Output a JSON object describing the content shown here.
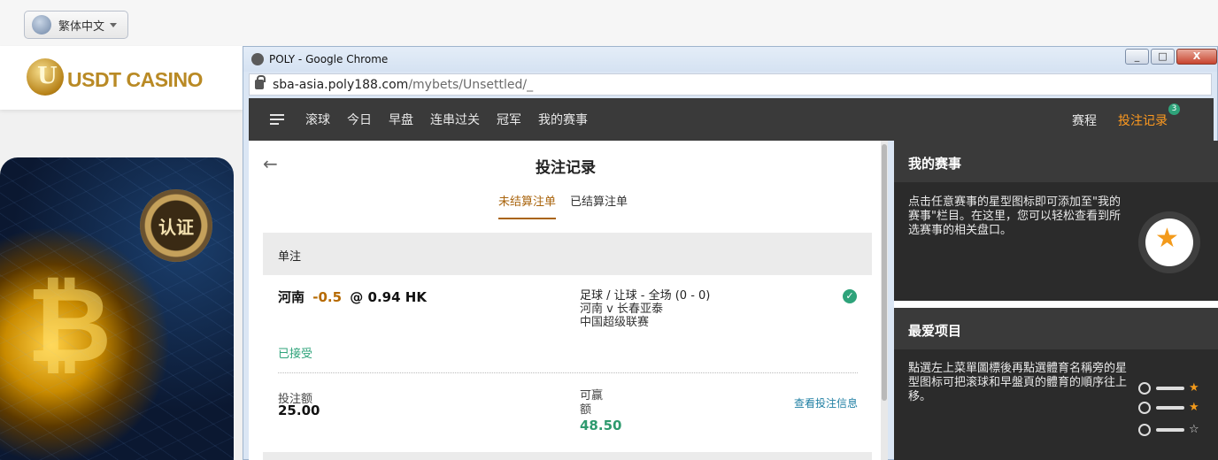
{
  "language": {
    "label": "繁体中文"
  },
  "site": {
    "brand": "USDT CASINO",
    "seal_text": "认证"
  },
  "browser": {
    "title": "POLY - Google Chrome",
    "url_host": "sba-asia.poly188.com",
    "url_path": "/mybets/Unsettled/_",
    "controls": {
      "minimize": "_",
      "maximize": "□",
      "close": "X"
    }
  },
  "nav": {
    "items": [
      "滚球",
      "今日",
      "早盘",
      "连串过关",
      "冠军",
      "我的赛事"
    ],
    "schedule": "赛程",
    "bet_record": "投注记录",
    "bet_record_count": "3"
  },
  "panel": {
    "title": "投注记录",
    "tabs": [
      "未结算注单",
      "已结算注单"
    ],
    "section": "单注",
    "bet": {
      "team": "河南",
      "handicap": "-0.5",
      "at": "@",
      "odds": "0.94 HK",
      "market": "足球 / 让球 - 全场 (0 - 0)",
      "match": "河南 v 长春亚泰",
      "league": "中国超级联赛",
      "status": "已接受",
      "stake_label": "投注额",
      "stake": "25.00",
      "win_label": "可赢额",
      "win": "48.50",
      "details_link": "查看投注信息"
    }
  },
  "sidebar": {
    "my_events_title": "我的赛事",
    "my_events_text": "点击任意赛事的星型图标即可添加至\"我的赛事\"栏目。在这里，您可以轻松查看到所选赛事的相关盘口。",
    "favorites_title": "最爱项目",
    "favorites_text": "點選左上菜單圖標後再點選體育名稱旁的星型图标可把滚球和早盤頁的體育的順序往上移。"
  },
  "colors": {
    "accent": "#ff9a1f",
    "success": "#2ea37a",
    "nav_bg": "#3a3a3a"
  }
}
